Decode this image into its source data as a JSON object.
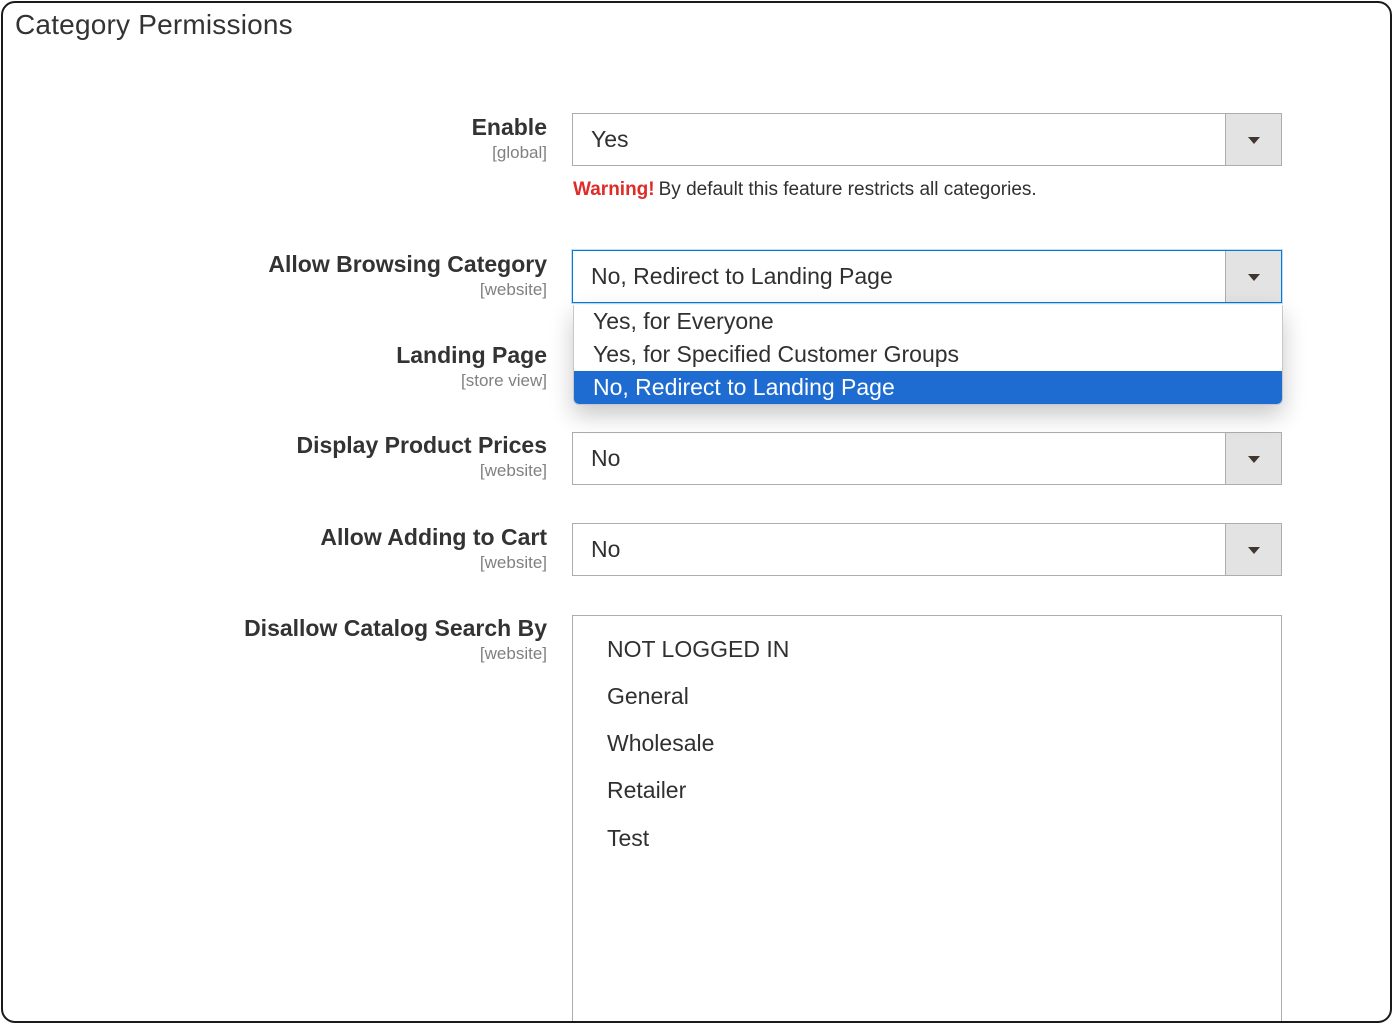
{
  "section": {
    "title": "Category Permissions"
  },
  "fields": {
    "enable": {
      "label": "Enable",
      "scope": "[global]",
      "value": "Yes"
    },
    "warning": {
      "strong": "Warning!",
      "text": "By default this feature restricts all categories."
    },
    "allow_browsing": {
      "label": "Allow Browsing Category",
      "scope": "[website]",
      "value": "No, Redirect to Landing Page",
      "options": [
        "Yes, for Everyone",
        "Yes, for Specified Customer Groups",
        "No, Redirect to Landing Page"
      ],
      "selected_index": 2
    },
    "landing_page": {
      "label": "Landing Page",
      "scope": "[store view]"
    },
    "display_prices": {
      "label": "Display Product Prices",
      "scope": "[website]",
      "value": "No"
    },
    "allow_cart": {
      "label": "Allow Adding to Cart",
      "scope": "[website]",
      "value": "No"
    },
    "disallow_search": {
      "label": "Disallow Catalog Search By",
      "scope": "[website]",
      "items": [
        "NOT LOGGED IN",
        "General",
        "Wholesale",
        "Retailer",
        "Test"
      ]
    }
  },
  "icons": {
    "dropdown_arrow": "triangle-down-icon"
  },
  "colors": {
    "warning": "#e02b27",
    "selected_option": "#1e6cd2",
    "focus_border": "#007bdb"
  }
}
